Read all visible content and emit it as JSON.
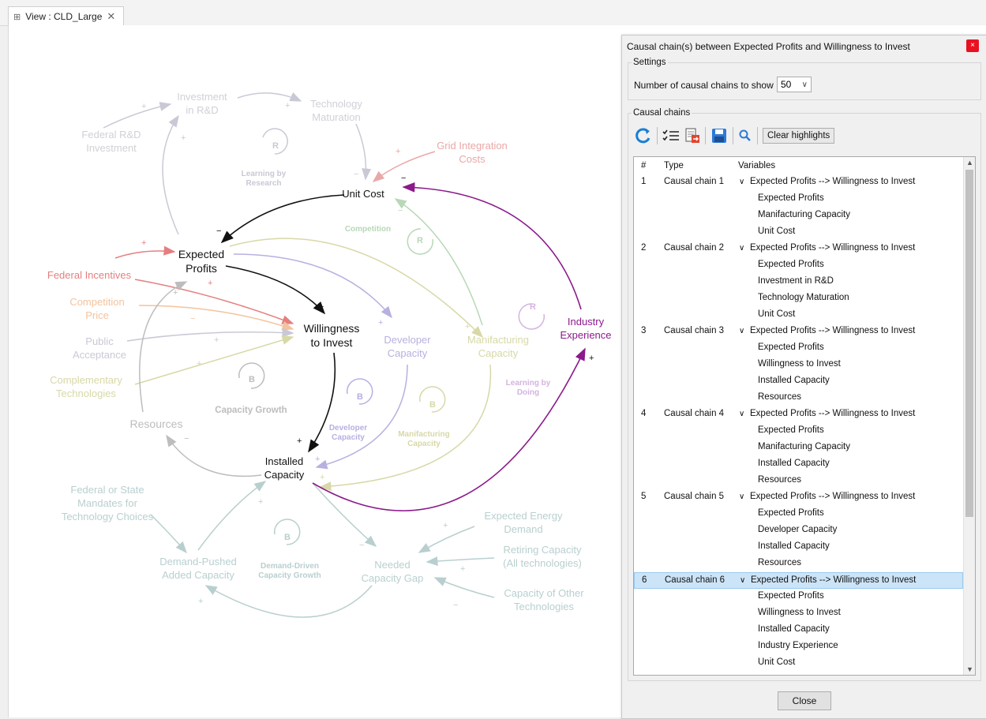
{
  "tab": {
    "icon": "view-icon",
    "title": "View : CLD_Large",
    "close": "✕"
  },
  "diagram": {
    "nodes": {
      "federal_rd": "Federal R&D\nInvestment",
      "investment_rd": "Investment\nin R&D",
      "tech_maturation": "Technology\nMaturation",
      "grid_integration": "Grid Integration\nCosts",
      "unit_cost": "Unit Cost",
      "expected_profits": "Expected\nProfits",
      "federal_incentives": "Federal Incentives",
      "competition_price": "Competition\nPrice",
      "public_acceptance": "Public\nAcceptance",
      "complementary_tech": "Complementary\nTechnologies",
      "willingness": "Willingness\nto Invest",
      "developer_capacity": "Developer\nCapacity",
      "manufacturing_capacity": "Manifacturing\nCapacity",
      "industry_experience": "Industry\nExperience",
      "resources": "Resources",
      "installed_capacity": "Installed\nCapacity",
      "federal_mandates": "Federal or State\nMandates for\nTechnology Choices",
      "demand_pushed": "Demand-Pushed\nAdded Capacity",
      "needed_gap": "Needed\nCapacity Gap",
      "expected_energy": "Expected Energy\nDemand",
      "retiring_capacity": "Retiring Capacity\n(All technologies)",
      "other_capacity": "Capacity of Other\nTechnologies"
    },
    "loops": {
      "learning_research": {
        "letter": "R",
        "name": "Learning by\nResearch"
      },
      "competition": {
        "letter": "R",
        "name": "Competition"
      },
      "learning_doing": {
        "letter": "R",
        "name": "Learning by\nDoing"
      },
      "capacity_growth": {
        "letter": "B",
        "name": "Capacity Growth"
      },
      "developer_capacity": {
        "letter": "B",
        "name": "Developer\nCapacity"
      },
      "manufacturing_capacity": {
        "letter": "B",
        "name": "Manifacturing\nCapacity"
      },
      "demand_driven": {
        "letter": "B",
        "name": "Demand-Driven\nCapacity Growth"
      }
    },
    "polarity": {
      "plus": "+",
      "minus": "−"
    }
  },
  "dialog": {
    "title": "Causal chain(s) between Expected Profits and Willingness to Invest",
    "close_icon": "×",
    "settings_legend": "Settings",
    "chains_to_show_label": "Number of causal chains to show :",
    "chains_to_show_value": "50",
    "chains_legend": "Causal chains",
    "clear_highlights": "Clear highlights",
    "close_button": "Close",
    "columns": {
      "num": "#",
      "type": "Type",
      "variables": "Variables"
    },
    "rows": [
      {
        "num": "1",
        "type": "Causal chain 1",
        "var": "Expected Profits --> Willingness to Invest",
        "parent": true
      },
      {
        "var": "Expected Profits"
      },
      {
        "var": "Manifacturing Capacity"
      },
      {
        "var": "Unit Cost"
      },
      {
        "num": "2",
        "type": "Causal chain 2",
        "var": "Expected Profits --> Willingness to Invest",
        "parent": true
      },
      {
        "var": "Expected Profits"
      },
      {
        "var": "Investment in R&D"
      },
      {
        "var": "Technology Maturation"
      },
      {
        "var": "Unit Cost"
      },
      {
        "num": "3",
        "type": "Causal chain 3",
        "var": "Expected Profits --> Willingness to Invest",
        "parent": true
      },
      {
        "var": "Expected Profits"
      },
      {
        "var": "Willingness to Invest"
      },
      {
        "var": "Installed Capacity"
      },
      {
        "var": "Resources"
      },
      {
        "num": "4",
        "type": "Causal chain 4",
        "var": "Expected Profits --> Willingness to Invest",
        "parent": true
      },
      {
        "var": "Expected Profits"
      },
      {
        "var": "Manifacturing Capacity"
      },
      {
        "var": "Installed Capacity"
      },
      {
        "var": "Resources"
      },
      {
        "num": "5",
        "type": "Causal chain 5",
        "var": "Expected Profits --> Willingness to Invest",
        "parent": true
      },
      {
        "var": "Expected Profits"
      },
      {
        "var": "Developer Capacity"
      },
      {
        "var": "Installed Capacity"
      },
      {
        "var": "Resources"
      },
      {
        "num": "6",
        "type": "Causal chain 6",
        "var": "Expected Profits --> Willingness to Invest",
        "parent": true,
        "selected": true
      },
      {
        "var": "Expected Profits"
      },
      {
        "var": "Willingness to Invest"
      },
      {
        "var": "Installed Capacity"
      },
      {
        "var": "Industry Experience"
      },
      {
        "var": "Unit Cost"
      }
    ],
    "chevron": "∨"
  },
  "colors": {
    "dark": "#111111",
    "purple": "#8b1a8b",
    "research": "#c9c9d6",
    "pink_faded": "#e9a8a8",
    "incentive_red": "#e57f7f",
    "orange_faded": "#f3c39e",
    "green_faded": "#b7d8b7",
    "lavender": "#b8b0e0",
    "olive_faded": "#d8d8a8",
    "grey_loop": "#bdbdbd",
    "teal_faded": "#b9cfcf",
    "select_bg": "#cce4f7",
    "close_red": "#e81123"
  }
}
